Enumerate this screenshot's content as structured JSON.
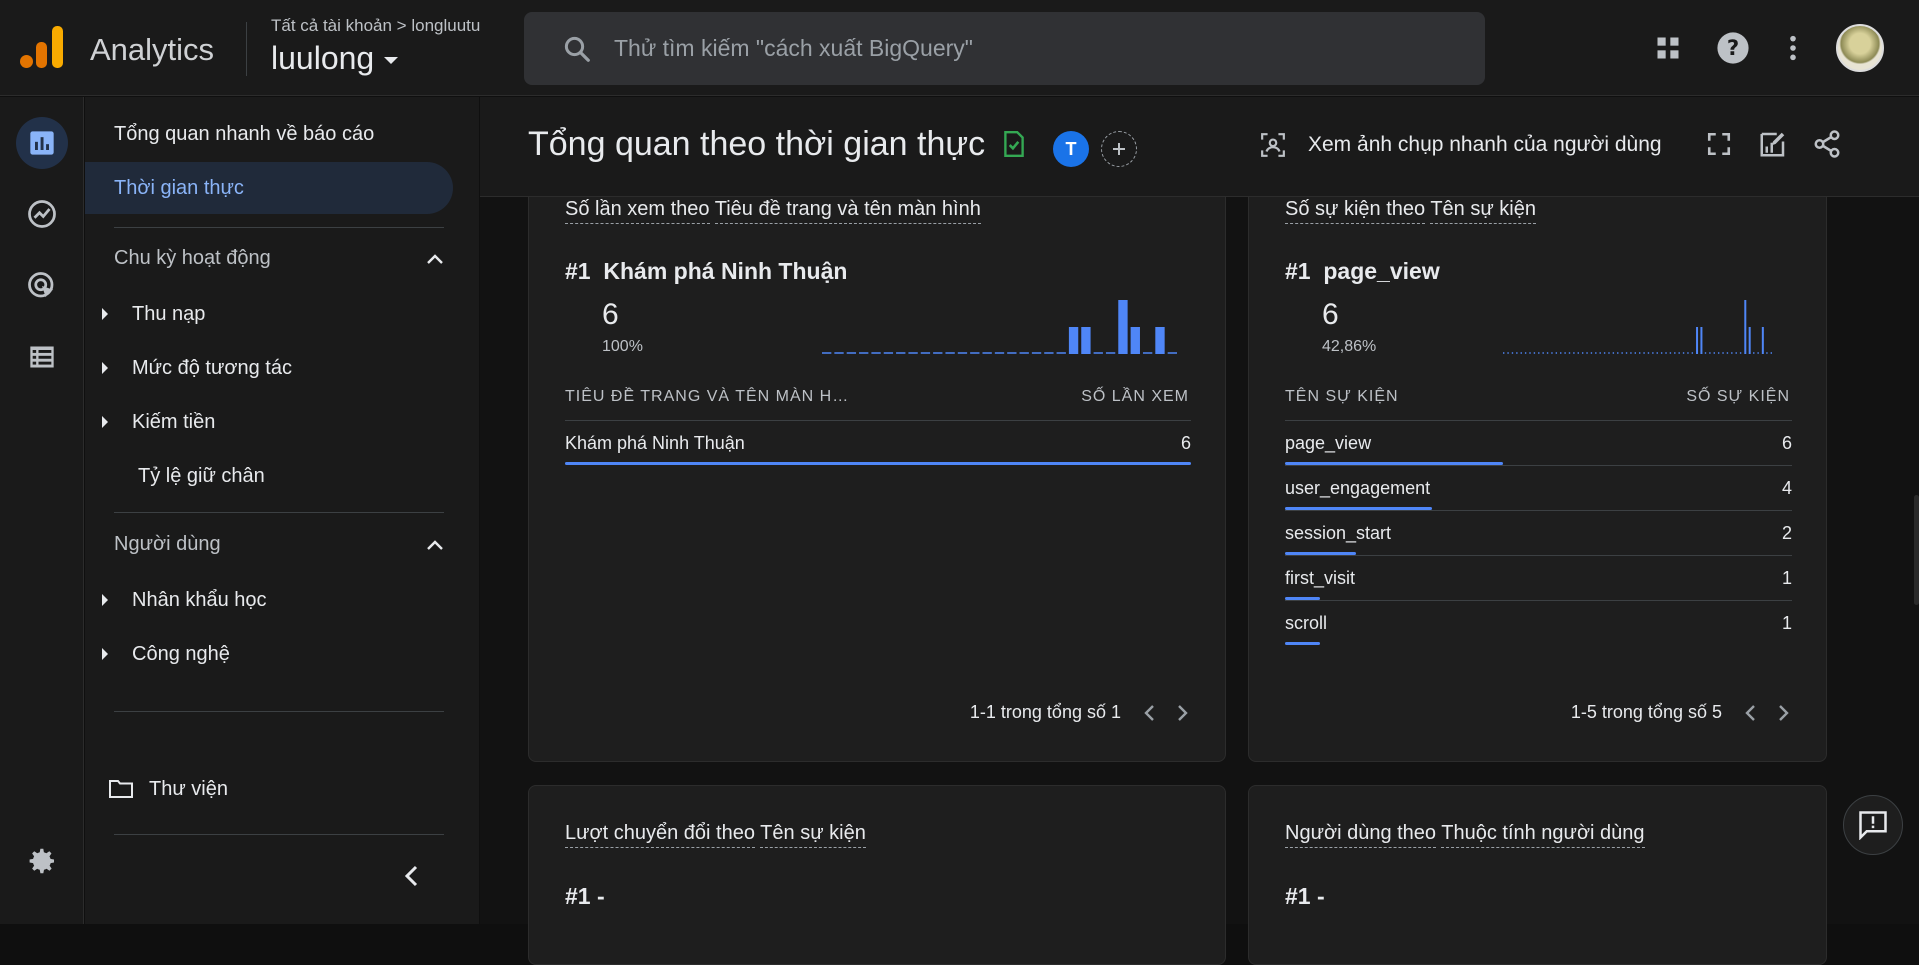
{
  "topbar": {
    "app_name": "Analytics",
    "account_crumb": "Tất cả tài khoản > longluutu",
    "account_name": "luulong",
    "search_placeholder": "Thử tìm kiếm \"cách xuất BigQuery\""
  },
  "nav": {
    "overview": "Tổng quan nhanh về báo cáo",
    "realtime": "Thời gian thực",
    "section_lifecycle": "Chu kỳ hoạt động",
    "lifecycle_items": [
      "Thu nạp",
      "Mức độ tương tác",
      "Kiếm tiền",
      "Tỷ lệ giữ chân"
    ],
    "section_user": "Người dùng",
    "user_items": [
      "Nhân khẩu học",
      "Công nghệ"
    ],
    "library": "Thư viện"
  },
  "header": {
    "title": "Tổng quan theo thời gian thực",
    "avatar_letter": "T",
    "snapshot_label": "Xem ảnh chụp nhanh của người dùng"
  },
  "cards": {
    "page_views": {
      "title_prefix": "Số lần xem theo",
      "title_dim": "Tiêu đề trang và tên màn hình",
      "rank": "#1",
      "top_name": "Khám phá Ninh Thuận",
      "top_value": "6",
      "top_pct": "100%",
      "col_dim": "TIÊU ĐỀ TRANG VÀ TÊN MÀN H…",
      "col_metric": "SỐ LẦN XEM",
      "rows": [
        {
          "label": "Khám phá Ninh Thuận",
          "value": "6",
          "share": 1.0
        }
      ],
      "pager": "1-1 trong tổng số 1",
      "spark": [
        0,
        0,
        0,
        0,
        0,
        0,
        0,
        0,
        0,
        0,
        0,
        0,
        0,
        0,
        0,
        0,
        0,
        0,
        0,
        0,
        1,
        1,
        0,
        0,
        2,
        1,
        0,
        1,
        0
      ]
    },
    "events": {
      "title_prefix": "Số sự kiện theo",
      "title_dim": "Tên sự kiện",
      "rank": "#1",
      "top_name": "page_view",
      "top_value": "6",
      "top_pct": "42,86%",
      "col_dim": "TÊN SỰ KIỆN",
      "col_metric": "SỐ SỰ KIỆN",
      "rows": [
        {
          "label": "page_view",
          "value": "6",
          "share": 0.43
        },
        {
          "label": "user_engagement",
          "value": "4",
          "share": 0.29
        },
        {
          "label": "session_start",
          "value": "2",
          "share": 0.14
        },
        {
          "label": "first_visit",
          "value": "1",
          "share": 0.07
        },
        {
          "label": "scroll",
          "value": "1",
          "share": 0.07
        }
      ],
      "pager": "1-5 trong tổng số 5",
      "spark": [
        0,
        0,
        0,
        0,
        0,
        0,
        0,
        0,
        0,
        0,
        0,
        0,
        0,
        0,
        0,
        0,
        0,
        0,
        0,
        0,
        0,
        0,
        0,
        0,
        0,
        0,
        0,
        0,
        0,
        0,
        0,
        0,
        0,
        0,
        0,
        0,
        0,
        0,
        0,
        0,
        0,
        0,
        0,
        0,
        1,
        1,
        0,
        0,
        0,
        0,
        0,
        0,
        0,
        0,
        0,
        2,
        1,
        0,
        0,
        1,
        0,
        0
      ]
    },
    "conversions": {
      "title_prefix": "Lượt chuyển đổi theo",
      "title_dim": "Tên sự kiện",
      "rank": "#1  -"
    },
    "user_props": {
      "title_prefix": "Người dùng theo",
      "title_dim": "Thuộc tính người dùng",
      "rank": "#1  -"
    }
  },
  "colors": {
    "accent": "#8ab4f8",
    "bar": "#4f86f7",
    "logo_orange": "#f9ab00",
    "logo_dark_orange": "#e37400",
    "check_green": "#34a853"
  }
}
